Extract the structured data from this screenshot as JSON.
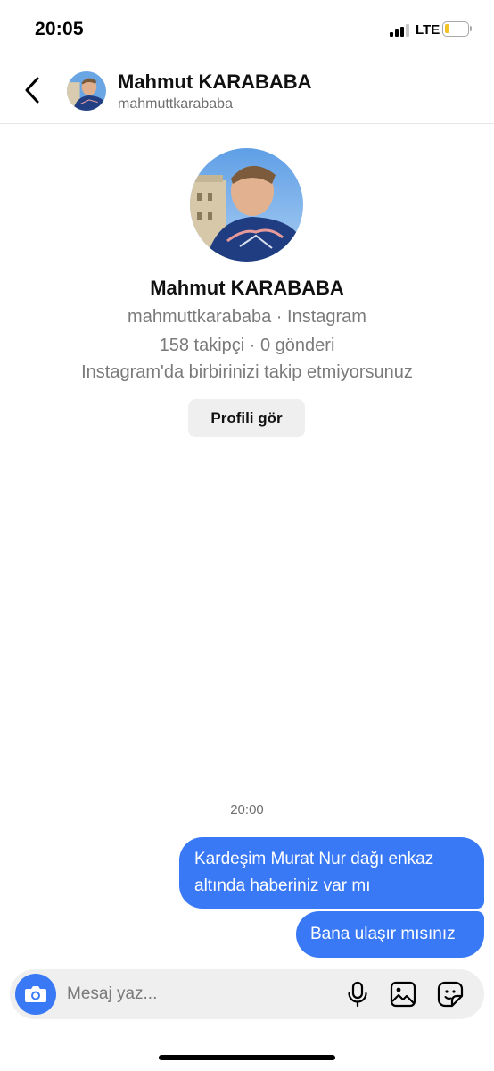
{
  "status_bar": {
    "time": "20:05",
    "network": "LTE",
    "battery_level": 0.2,
    "battery_color": "#f2c322"
  },
  "header": {
    "back_icon": "chevron-left-icon",
    "name": "Mahmut KARABABA",
    "username": "mahmuttkarababa"
  },
  "profile": {
    "name": "Mahmut KARABABA",
    "source_line": "mahmuttkarababa · Instagram",
    "stats_line": "158 takipçi · 0 gönderi",
    "follow_status": "Instagram'da birbirinizi takip etmiyorsunuz",
    "view_profile_label": "Profili gör"
  },
  "conversation": {
    "timestamp": "20:00",
    "messages": [
      {
        "sender": "me",
        "text": "Kardeşim Murat Nur dağı enkaz altında haberiniz var mı"
      },
      {
        "sender": "me",
        "text": "Bana ulaşır mısınız"
      }
    ]
  },
  "composer": {
    "placeholder": "Mesaj yaz...",
    "icons": [
      "camera-icon",
      "microphone-icon",
      "gallery-icon",
      "sticker-icon"
    ]
  },
  "colors": {
    "accent": "#3a79f5",
    "bubble_text": "#ffffff",
    "secondary_text": "#7a7a7a",
    "button_bg": "#efefef"
  }
}
